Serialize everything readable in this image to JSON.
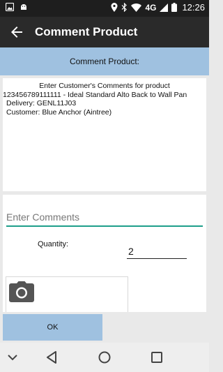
{
  "status_bar": {
    "time": "12:26",
    "network": "4G",
    "icons": [
      "image-icon",
      "android-icon",
      "location-icon",
      "bluetooth-icon",
      "wifi-icon",
      "signal-icon",
      "battery-icon"
    ]
  },
  "app_bar": {
    "title": "Comment Product",
    "back_icon": "back-arrow-icon"
  },
  "section_header": {
    "label": "Comment Product:"
  },
  "info": {
    "instruction": "Enter Customer's Comments for product",
    "product": "123456789111111 - Ideal Standard Alto Back to Wall Pan",
    "delivery": "Delivery: GENL11J03",
    "customer": "Customer: Blue Anchor (Aintree)"
  },
  "form": {
    "comments_value": "",
    "comments_placeholder": "Enter Comments",
    "quantity_label": "Quantity:",
    "quantity_value": "2",
    "photo_icon": "camera-icon"
  },
  "actions": {
    "ok_label": "OK"
  },
  "nav_bar": {
    "icons": [
      "chevron-down-icon",
      "back-triangle-icon",
      "home-circle-icon",
      "recents-square-icon"
    ]
  },
  "colors": {
    "header_blue": "#9fc1e0",
    "app_bar": "#2a2a2a",
    "accent_teal": "#1e9e8a"
  }
}
